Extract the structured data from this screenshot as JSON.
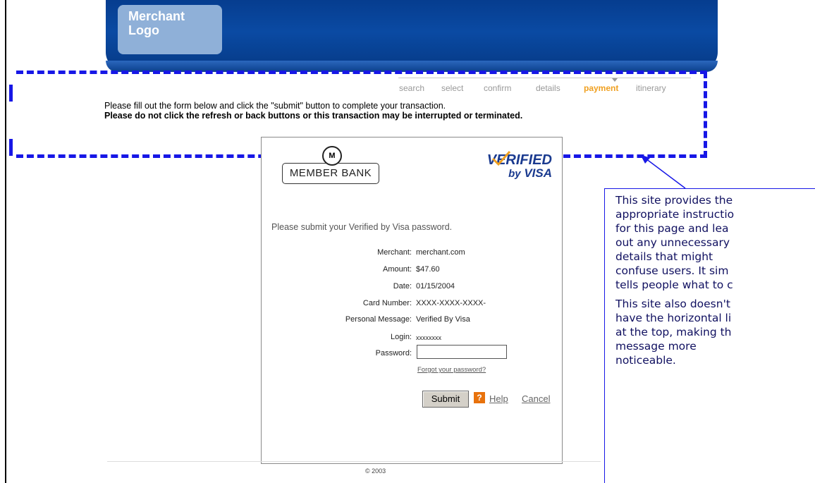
{
  "header": {
    "merchant_logo": "Merchant\nLogo",
    "bar_color": "#0a4aa3"
  },
  "steps": {
    "items": [
      "search",
      "select",
      "confirm",
      "details",
      "payment",
      "itinerary"
    ],
    "active": "payment",
    "active_color": "#f0a020"
  },
  "instructions": {
    "line1": "Please fill out the form below and click the \"submit\" button to complete your transaction.",
    "line2": "Please do not click the refresh or back buttons or this transaction may be interrupted or terminated."
  },
  "panel": {
    "bank_logo_text": "MEMBER BANK",
    "bank_monogram": "M",
    "visa_line1": "VERIFIED",
    "visa_by": "by",
    "visa_line2": "VISA",
    "prompt": "Please submit your Verified by Visa password.",
    "fields": [
      {
        "label": "Merchant:",
        "value": "merchant.com"
      },
      {
        "label": "Amount:",
        "value": "$47.60"
      },
      {
        "label": "Date:",
        "value": "01/15/2004"
      },
      {
        "label": "Card Number:",
        "value": "XXXX-XXXX-XXXX-"
      },
      {
        "label": "Personal Message:",
        "value": "Verified By Visa"
      },
      {
        "label": "Login:",
        "value": "xxxxxxxx"
      },
      {
        "label": "Password:",
        "value": ""
      }
    ],
    "forgot_link": "Forgot your password?",
    "submit_label": "Submit",
    "help_icon": "?",
    "help_link": "Help",
    "cancel_link": "Cancel"
  },
  "footer": {
    "copyright": "© 2003"
  },
  "callout": {
    "paragraph1_lines": [
      "This site provides the",
      "appropriate instructio",
      "for this page and lea",
      "out any unnecessary",
      "details that might",
      "confuse users. It sim",
      "tells people what to c"
    ],
    "paragraph2_lines": [
      "This site also doesn't",
      "have the horizontal li",
      "at the top, making th",
      "message more",
      "noticeable."
    ],
    "highlight_color": "#1717e6"
  }
}
